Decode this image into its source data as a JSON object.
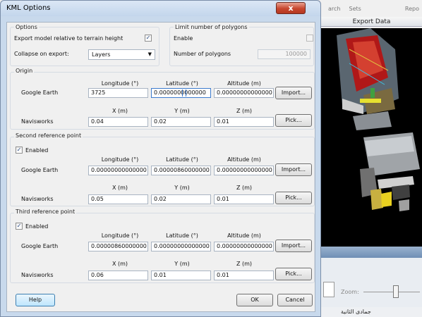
{
  "background": {
    "menu": [
      "arch",
      "Sets",
      "Repo"
    ],
    "header": "Export Data",
    "zoom_label": "Zoom:",
    "status_text": "جمادى الثانية"
  },
  "dialog": {
    "title": "KML Options",
    "close_glyph": "x",
    "options": {
      "group_label": "Options",
      "export_relative_label": "Export model relative to terrain height",
      "export_relative_checked": true,
      "collapse_label": "Collapse on export:",
      "collapse_value": "Layers"
    },
    "limit": {
      "group_label": "Limit number of polygons",
      "enable_label": "Enable",
      "enable_checked": false,
      "number_label": "Number of polygons",
      "number_value": "100000"
    },
    "origin": {
      "group_label": "Origin",
      "ge_label": "Google Earth",
      "nw_label": "Navisworks",
      "col_longitude": "Longitude (°)",
      "col_latitude": "Latitude (°)",
      "col_altitude": "Altitude (m)",
      "col_x": "X (m)",
      "col_y": "Y (m)",
      "col_z": "Z (m)",
      "longitude": "3725",
      "latitude": "0.0000000000000",
      "altitude": "0.00000000000000",
      "x": "0.04",
      "y": "0.02",
      "z": "0.01",
      "import_label": "Import...",
      "pick_label": "Pick..."
    },
    "second": {
      "group_label": "Second reference point",
      "enabled_label": "Enabled",
      "enabled_checked": true,
      "ge_label": "Google Earth",
      "nw_label": "Navisworks",
      "col_longitude": "Longitude (°)",
      "col_latitude": "Latitude (°)",
      "col_altitude": "Altitude (m)",
      "col_x": "X (m)",
      "col_y": "Y (m)",
      "col_z": "Z (m)",
      "longitude": "0.00000000000000",
      "latitude": "0.00000860000000",
      "altitude": "0.00000000000000",
      "x": "0.05",
      "y": "0.02",
      "z": "0.01",
      "import_label": "Import...",
      "pick_label": "Pick..."
    },
    "third": {
      "group_label": "Third reference point",
      "enabled_label": "Enabled",
      "enabled_checked": true,
      "ge_label": "Google Earth",
      "nw_label": "Navisworks",
      "col_longitude": "Longitude (°)",
      "col_latitude": "Latitude (°)",
      "col_altitude": "Altitude (m)",
      "col_x": "X (m)",
      "col_y": "Y (m)",
      "col_z": "Z (m)",
      "longitude": "0.00000860000000",
      "latitude": "0.00000000000000",
      "altitude": "0.00000000000000",
      "x": "0.06",
      "y": "0.01",
      "z": "0.01",
      "import_label": "Import...",
      "pick_label": "Pick..."
    },
    "help_label": "Help",
    "ok_label": "OK",
    "cancel_label": "Cancel"
  }
}
